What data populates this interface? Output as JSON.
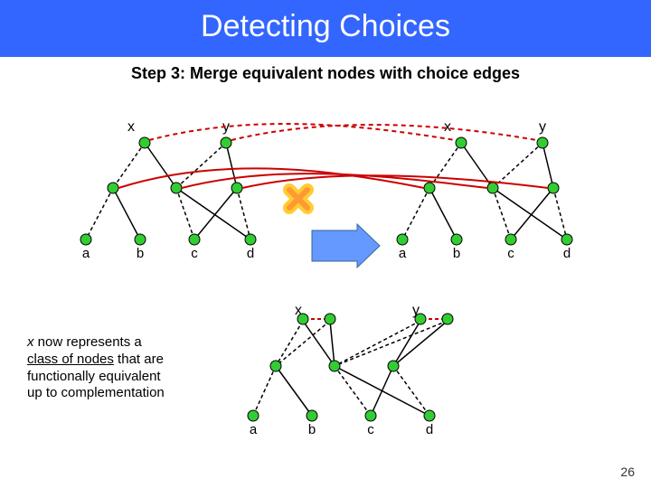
{
  "title": "Detecting Choices",
  "subtitle": "Step 3: Merge equivalent nodes with choice edges",
  "labels": {
    "x": "x",
    "y": "y",
    "a": "a",
    "b": "b",
    "c": "c",
    "d": "d"
  },
  "caption": {
    "line1_i": "x",
    "line1_rest": " now represents a",
    "line2_u": "class of nodes",
    "line2_rest": " that are",
    "line3": "functionally equivalent",
    "line4": "up to complementation"
  },
  "page_number": "26"
}
